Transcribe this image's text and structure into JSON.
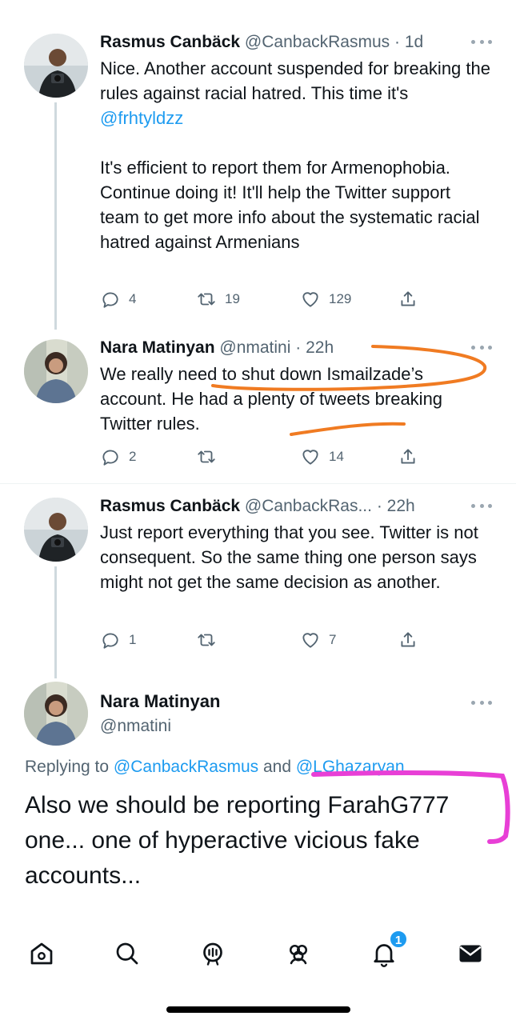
{
  "tweets": [
    {
      "name": "Rasmus Canbäck",
      "handle": "@CanbackRasmus",
      "time": "1d",
      "text_before": "Nice. Another account suspended for breaking the rules against racial hatred. This time it's ",
      "mention": "@frhtyldzz",
      "text_after": "\n\nIt's efficient to report them for Armenophobia. Continue doing it! It'll help the Twitter support team to get more info about the systematic racial hatred against Armenians",
      "replies": "4",
      "retweets": "19",
      "likes": "129"
    },
    {
      "name": "Nara Matinyan",
      "handle": "@nmatini",
      "time": "22h",
      "text": "We really need to shut down Ismailzade’s account. He had a plenty of tweets breaking Twitter rules.",
      "replies": "2",
      "retweets": "",
      "likes": "14"
    },
    {
      "name": "Rasmus Canbäck",
      "handle": "@CanbackRas...",
      "time": "22h",
      "text": "Just report everything that you see. Twitter is not consequent. So the same thing one person says might not get the same decision as another.",
      "replies": "1",
      "retweets": "",
      "likes": "7"
    }
  ],
  "main_tweet": {
    "name": "Nara Matinyan",
    "handle": "@nmatini",
    "replying_prefix": "Replying to ",
    "replying_user1": "@CanbackRasmus",
    "replying_and": " and ",
    "replying_user2": "@LGhazaryan",
    "text": "Also we should be reporting FarahG777 one... one of hyperactive vicious fake accounts..."
  },
  "dot": "·",
  "tabbar": {
    "items": [
      "home-icon",
      "search-icon",
      "spaces-icon",
      "communities-icon",
      "notifications-icon",
      "messages-icon"
    ],
    "notification_badge": "1"
  },
  "colors": {
    "accent": "#1d9bf0",
    "secondary_text": "#536471",
    "annotation_orange": "#f07b22",
    "annotation_magenta": "#e83fd6"
  }
}
